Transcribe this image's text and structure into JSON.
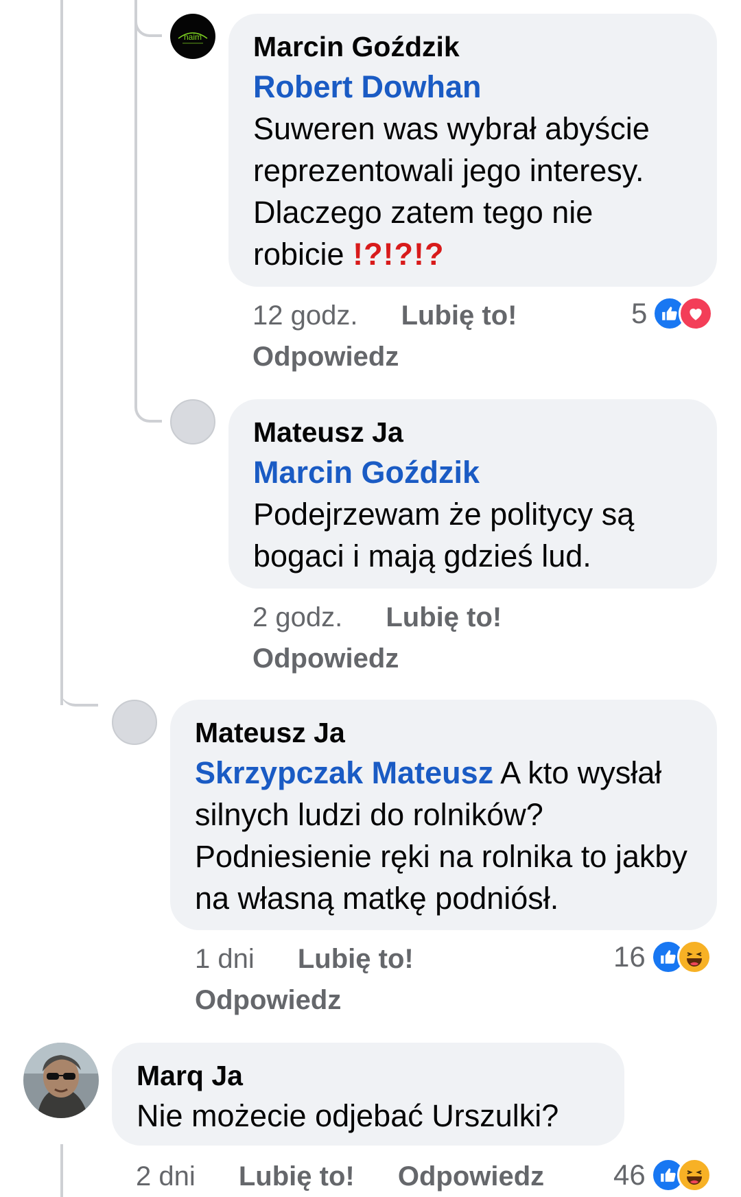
{
  "comments": [
    {
      "author": "Marcin Goździk",
      "mention": "Robert Dowhan",
      "text": "Suweren was wybrał abyście reprezentowali jego interesy. Dlaczego zatem tego nie robicie",
      "emphasis": "⁉️⁉️⁉️",
      "avatar_logo": "naim",
      "time": "12 godz.",
      "like_label": "Lubię to!",
      "reply_label": "Odpowiedz",
      "reaction_count": "5",
      "reactions": [
        "like-icon",
        "heart-icon"
      ]
    },
    {
      "author": "Mateusz Ja",
      "mention": "Marcin Goździk",
      "text": "Podejrzewam że politycy są bogaci i mają gdzieś lud.",
      "time": "2 godz.",
      "like_label": "Lubię to!",
      "reply_label": "Odpowiedz"
    },
    {
      "author": "Mateusz Ja",
      "mention": "Skrzypczak Mateusz",
      "text": " A kto wysłał silnych ludzi do rolników? Podniesienie ręki na rolnika to jakby na własną matkę podniósł.",
      "time": "1 dni",
      "like_label": "Lubię to!",
      "reply_label": "Odpowiedz",
      "reaction_count": "16",
      "reactions": [
        "like-icon",
        "haha-icon"
      ]
    },
    {
      "author": "Marq Ja",
      "text": "Nie możecie odjebać Urszulki?",
      "time": "2 dni",
      "like_label": "Lubię to!",
      "reply_label": "Odpowiedz",
      "reaction_count": "46",
      "reactions": [
        "like-icon",
        "haha-icon"
      ]
    }
  ],
  "colors": {
    "mention": "#1a5bc4",
    "bubble": "#f0f2f5",
    "meta": "#65676b",
    "like_reaction": "#1877f2",
    "heart_reaction": "#f33e58",
    "haha_reaction": "#f7b125"
  }
}
